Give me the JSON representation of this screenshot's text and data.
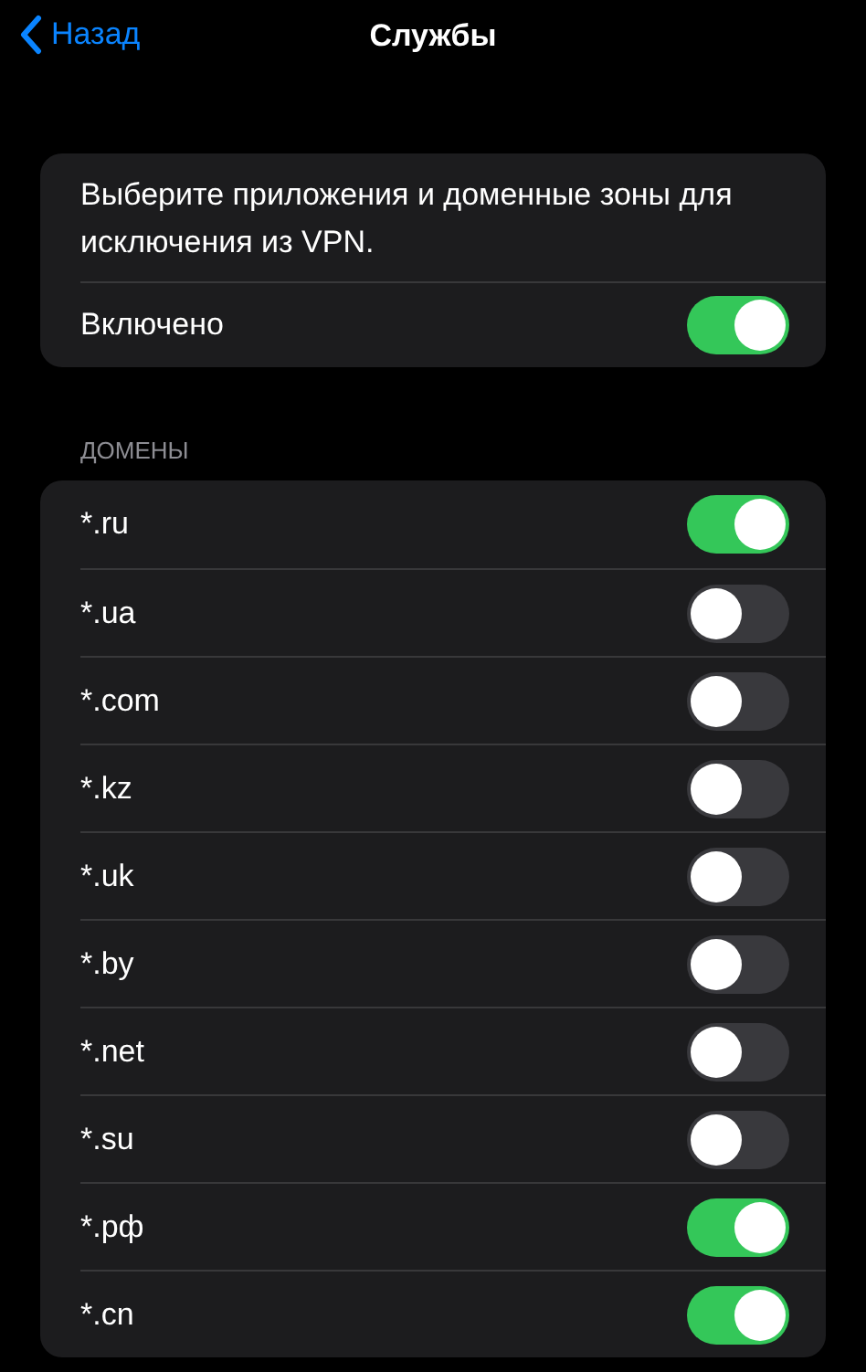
{
  "nav": {
    "back": "Назад",
    "title": "Службы"
  },
  "intro": {
    "description": "Выберите приложения и доменные зоны для исключения из VPN.",
    "toggle": {
      "label": "Включено",
      "on": true
    }
  },
  "domains": {
    "heading": "ДОМЕНЫ",
    "items": [
      {
        "label": "*.ru",
        "on": true
      },
      {
        "label": "*.ua",
        "on": false
      },
      {
        "label": "*.com",
        "on": false
      },
      {
        "label": "*.kz",
        "on": false
      },
      {
        "label": "*.uk",
        "on": false
      },
      {
        "label": "*.by",
        "on": false
      },
      {
        "label": "*.net",
        "on": false
      },
      {
        "label": "*.su",
        "on": false
      },
      {
        "label": "*.рф",
        "on": true
      },
      {
        "label": "*.cn",
        "on": true
      }
    ]
  }
}
